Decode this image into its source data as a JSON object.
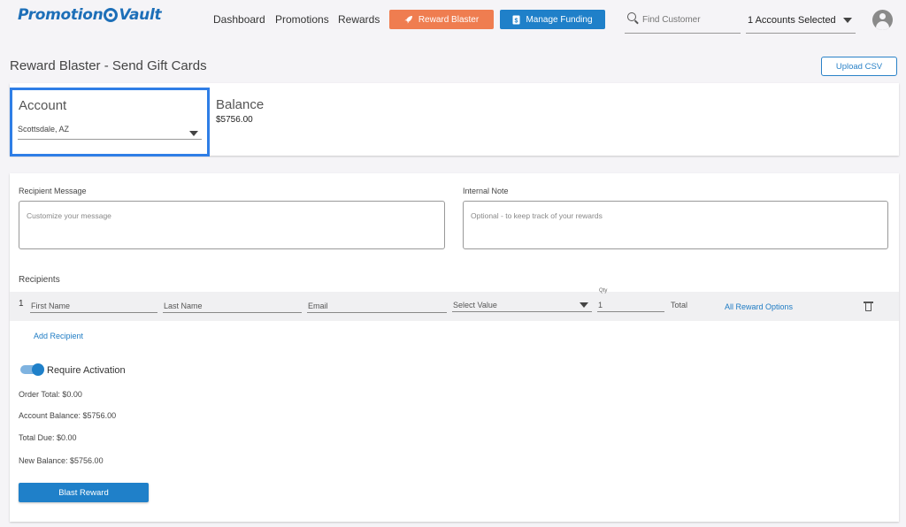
{
  "header": {
    "logo_left": "Promotion",
    "logo_right": "Vault",
    "nav": [
      "Dashboard",
      "Promotions",
      "Rewards"
    ],
    "reward_blaster_label": "Reward Blaster",
    "manage_funding_label": "Manage Funding",
    "search_placeholder": "Find Customer",
    "accounts_selected": "1 Accounts Selected"
  },
  "page": {
    "title": "Reward Blaster - Send Gift Cards",
    "upload_csv": "Upload CSV"
  },
  "account": {
    "label": "Account",
    "value": "Scottsdale, AZ",
    "balance_label": "Balance",
    "balance_value": "$5756.00"
  },
  "form": {
    "recipient_message_label": "Recipient Message",
    "recipient_message_placeholder": "Customize your message",
    "internal_note_label": "Internal Note",
    "internal_note_placeholder": "Optional - to keep track of your rewards",
    "recipients_label": "Recipients",
    "row": {
      "number": "1",
      "first_name": "First Name",
      "last_name": "Last Name",
      "email": "Email",
      "select_value": "Select Value",
      "qty_label": "Qty",
      "qty": "1",
      "total": "Total",
      "all_reward_options": "All Reward Options"
    },
    "add_recipient": "Add Recipient",
    "require_activation": "Require Activation",
    "require_activation_on": true,
    "order_total": "Order Total: $0.00",
    "account_balance": "Account Balance: $5756.00",
    "total_due": "Total Due: $0.00",
    "new_balance": "New Balance: $5756.00",
    "blast_reward": "Blast Reward"
  },
  "colors": {
    "accent": "#1f80c9",
    "orange": "#ef7d50",
    "highlight_border": "#2f7ee6"
  }
}
